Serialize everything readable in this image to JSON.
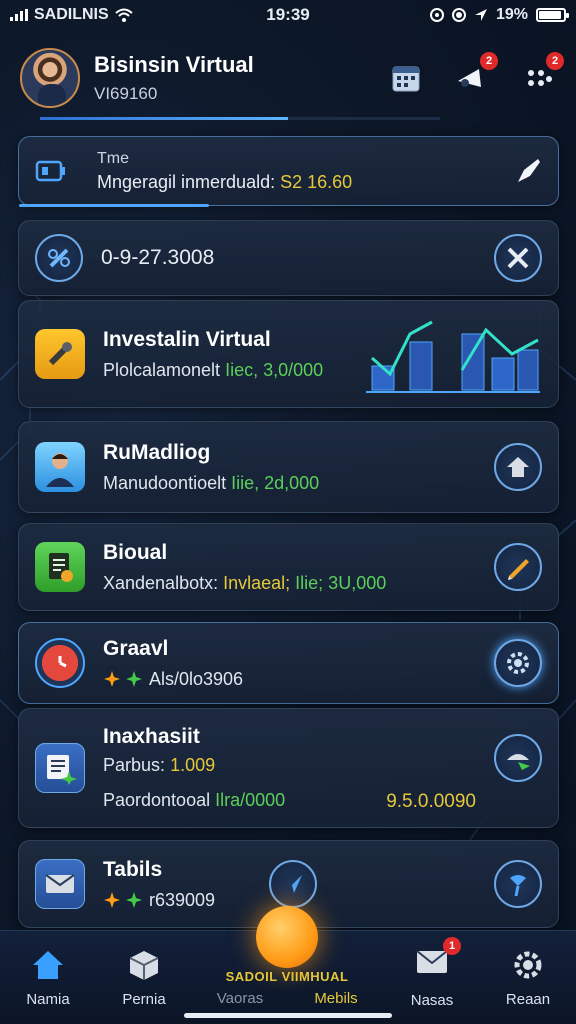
{
  "status": {
    "carrier": "SADILNIS",
    "time": "19:39",
    "battery": "19%"
  },
  "header": {
    "title": "Bisinsin Virtual",
    "subtitle": "VI69160",
    "badge_counts": [
      "2",
      "2"
    ]
  },
  "top_card": {
    "label": "Tme",
    "text": "Mngeragil inmerduald:",
    "amount": "S2 16.60"
  },
  "id_card": {
    "value": "0-9-27.3008"
  },
  "cards": [
    {
      "title": "Investalin Virtual",
      "desc": "Plolcalamonelt",
      "amount": "Iiec, 3,0/000"
    },
    {
      "title": "RuMadliog",
      "desc": "Manudoontioelt",
      "amount": "Iiie, 2d,000"
    },
    {
      "title": "Bioual",
      "desc": "Xandenalbotx:",
      "highlight": "Invlaeal;",
      "amount": "Ilie; 3U,000"
    },
    {
      "title": "Graavl",
      "desc": "Als/0lo3906"
    },
    {
      "title": "Inaxhasiit",
      "sub": "Parbus:",
      "sub_amount": "1.009",
      "desc": "Paordontooal",
      "amount": "Ilra/0000",
      "right_amount": "9.5.0.0090"
    },
    {
      "title": "Tabils",
      "desc": "r639009"
    }
  ],
  "nav": {
    "items": [
      "Namia",
      "Pernia",
      "Vaoras",
      "Mebils",
      "Nasas",
      "Reaan"
    ],
    "center_label": "SADOIL VIIMHUAL",
    "badge": "1"
  },
  "colors": {
    "accent": "#5fb4ff",
    "green": "#5ad05a",
    "yellow": "#e5c83a",
    "orange": "#ff9b16"
  }
}
